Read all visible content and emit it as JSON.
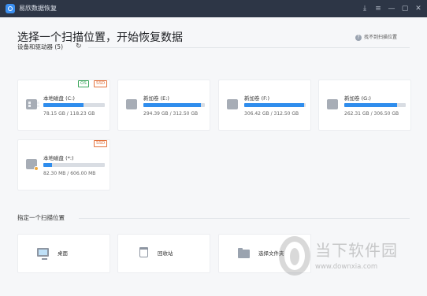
{
  "window": {
    "title": "易欣数据恢复",
    "controls": [
      "download-icon",
      "menu-icon",
      "minimize-icon",
      "maximize-icon",
      "close-icon"
    ],
    "control_glyphs": [
      "⤓",
      "≡",
      "—",
      "▢",
      "✕"
    ]
  },
  "header": {
    "title": "选择一个扫描位置，开始恢复数据",
    "help_label": "找不到扫描位置",
    "help_glyph": "?"
  },
  "devices": {
    "section_title": "设备和驱动器 (5)",
    "refresh_glyph": "↻",
    "drives": [
      {
        "name": "本地磁盘 (C:)",
        "used": "78.15 GB",
        "total": "118.23 GB",
        "size_text": "78.15 GB / 118.23 GB",
        "usage": 0.66,
        "badges": [
          "OS",
          "SSD"
        ],
        "icon": "windows-drive-icon"
      },
      {
        "name": "新加卷 (E:)",
        "used": "294.39 GB",
        "total": "312.50 GB",
        "size_text": "294.39 GB / 312.50 GB",
        "usage": 0.94,
        "badges": [],
        "icon": "drive-icon"
      },
      {
        "name": "新加卷 (F:)",
        "used": "306.42 GB",
        "total": "312.50 GB",
        "size_text": "306.42 GB / 312.50 GB",
        "usage": 0.98,
        "badges": [],
        "icon": "drive-icon"
      },
      {
        "name": "新加卷 (G:)",
        "used": "262.31 GB",
        "total": "306.50 GB",
        "size_text": "262.31 GB / 306.50 GB",
        "usage": 0.86,
        "badges": [],
        "icon": "drive-icon"
      },
      {
        "name": "本地磁盘 (*:)",
        "used": "82.30 MB",
        "total": "606.00 MB",
        "size_text": "82.30 MB / 606.00 MB",
        "usage": 0.14,
        "badges": [
          "SSD"
        ],
        "icon": "drive-warning-icon"
      }
    ]
  },
  "locations": {
    "section_title": "指定一个扫描位置",
    "items": [
      {
        "label": "桌面",
        "icon": "desktop-icon"
      },
      {
        "label": "回收站",
        "icon": "recycle-bin-icon"
      },
      {
        "label": "选择文件夹",
        "icon": "folder-icon"
      }
    ]
  },
  "watermark": {
    "text": "当下软件园",
    "url": "www.downxia.com"
  },
  "colors": {
    "titlebar": "#2d3646",
    "accent": "#2f8ded",
    "badge_os": "#3aa55a",
    "badge_ssd": "#e3713a"
  }
}
